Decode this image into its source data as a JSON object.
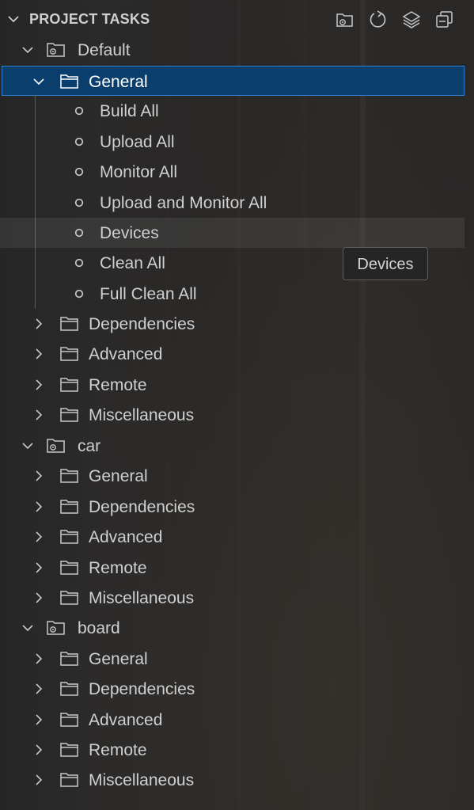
{
  "panel": {
    "title": "PROJECT TASKS",
    "header_icons": [
      "new-folder-icon",
      "refresh-icon",
      "layers-icon",
      "collapse-all-icon"
    ]
  },
  "tree": [
    {
      "label": "Default",
      "expanded": true,
      "folders": [
        {
          "label": "General",
          "expanded": true,
          "selected": true,
          "tasks": [
            "Build All",
            "Upload All",
            "Monitor All",
            "Upload and Monitor All",
            "Devices",
            "Clean All",
            "Full Clean All"
          ]
        },
        {
          "label": "Dependencies",
          "expanded": false
        },
        {
          "label": "Advanced",
          "expanded": false
        },
        {
          "label": "Remote",
          "expanded": false
        },
        {
          "label": "Miscellaneous",
          "expanded": false
        }
      ]
    },
    {
      "label": "car",
      "expanded": true,
      "folders": [
        {
          "label": "General",
          "expanded": false
        },
        {
          "label": "Dependencies",
          "expanded": false
        },
        {
          "label": "Advanced",
          "expanded": false
        },
        {
          "label": "Remote",
          "expanded": false
        },
        {
          "label": "Miscellaneous",
          "expanded": false
        }
      ]
    },
    {
      "label": "board",
      "expanded": true,
      "folders": [
        {
          "label": "General",
          "expanded": false
        },
        {
          "label": "Dependencies",
          "expanded": false
        },
        {
          "label": "Advanced",
          "expanded": false
        },
        {
          "label": "Remote",
          "expanded": false
        },
        {
          "label": "Miscellaneous",
          "expanded": false
        }
      ]
    }
  ],
  "hovered_task": "Devices",
  "tooltip": {
    "text": "Devices"
  },
  "colors": {
    "selection_bg": "#0a3f6d",
    "selection_border": "#2f7ecf",
    "text": "#d0d0d0"
  }
}
